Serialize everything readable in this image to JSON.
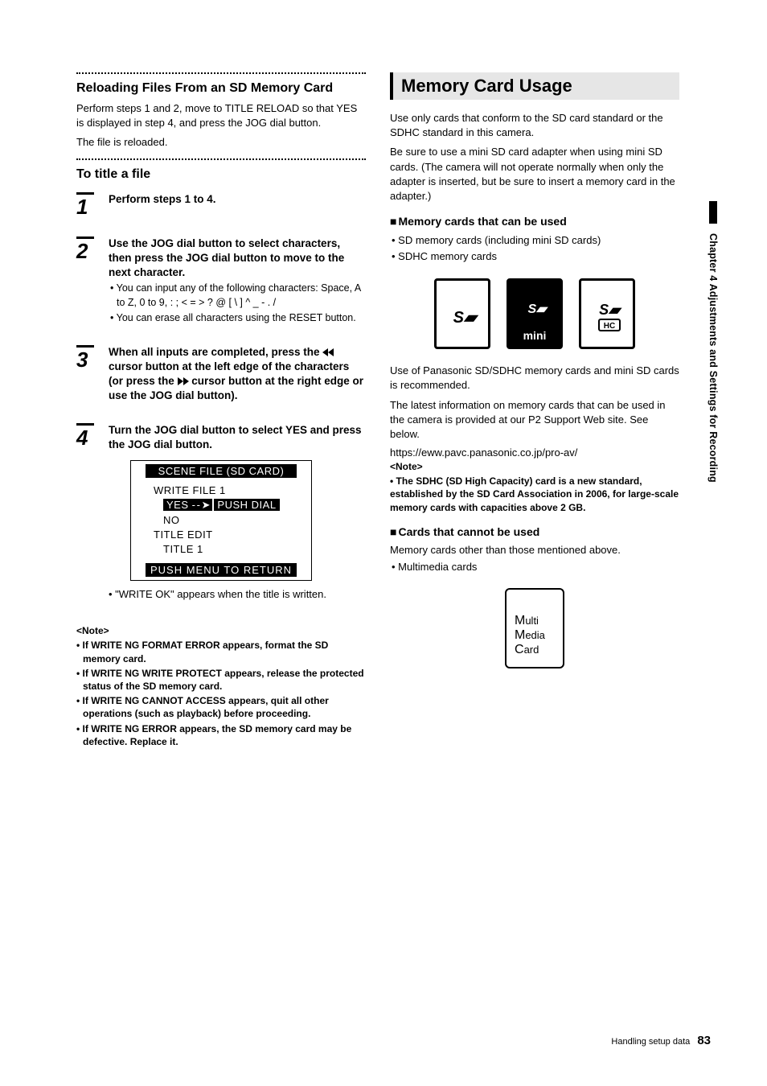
{
  "left": {
    "h1": "Reloading Files From an SD Memory Card",
    "p1": "Perform steps 1 and 2, move to TITLE RELOAD so that YES is displayed in step 4, and press the JOG dial button.",
    "p2": "The file is reloaded.",
    "h2": "To title a file",
    "steps": {
      "s1": {
        "lead": "Perform steps 1 to 4."
      },
      "s2": {
        "lead": "Use the JOG dial button to select characters, then press the JOG dial button to move to the next character.",
        "b1": "• You can input any of the following characters: Space, A to Z, 0 to 9, : ; < = > ? @ [ \\ ] ^ _ - . /",
        "b2": "• You can erase all characters using the RESET button."
      },
      "s3": {
        "lead_a": "When all inputs are completed, press the ",
        "lead_b": " cursor button at the left edge of the characters (or press the ",
        "lead_c": " cursor button at the right edge or use the JOG dial button)."
      },
      "s4": {
        "lead": "Turn the JOG dial button to select YES and press the JOG dial button."
      }
    },
    "menu": {
      "title": "SCENE FILE (SD CARD)",
      "r1": "WRITE FILE 1",
      "r2a": "YES",
      "r2b": "- - ➤",
      "r2c": "PUSH DIAL",
      "r3": "NO",
      "r4": "TITLE EDIT",
      "r5": "TITLE 1",
      "bottom": "PUSH  MENU  TO  RETURN"
    },
    "after_menu": "• \"WRITE OK\" appears when the title is written.",
    "notes": {
      "head": "<Note>",
      "n1": "• If WRITE NG FORMAT ERROR appears, format the SD memory card.",
      "n2": "• If WRITE NG WRITE PROTECT appears, release the protected status of the SD memory card.",
      "n3": "• If WRITE NG CANNOT ACCESS appears, quit all other operations (such as playback) before proceeding.",
      "n4": "• If WRITE NG ERROR appears, the SD memory card may be defective. Replace it."
    }
  },
  "right": {
    "title": "Memory Card Usage",
    "p1": "Use only cards that conform to the SD card standard or the SDHC standard in this camera.",
    "p2": "Be sure to use a mini SD card adapter when using mini SD cards. (The camera will not operate normally when only the adapter is inserted, but be sure to insert a memory card in the adapter.)",
    "h1": "Memory cards that can be used",
    "b1": "• SD memory cards (including mini SD cards)",
    "b2": "• SDHC memory cards",
    "p3": "Use of Panasonic SD/SDHC memory cards and mini SD cards is recommended.",
    "p4": "The latest information on memory cards that can be used in the camera is provided at our P2 Support Web site. See below.",
    "url": "https://eww.pavc.panasonic.co.jp/pro-av/",
    "notehead": "<Note>",
    "note1": "• The SDHC (SD High Capacity) card is a new standard, established by the SD Card Association in 2006, for large-scale memory cards with capacities above 2 GB.",
    "h2": "Cards that cannot be used",
    "p5": "Memory cards other than those mentioned above.",
    "b3": "• Multimedia cards",
    "mmc": {
      "l1": "Multi",
      "l2": "Media",
      "l3": "Card"
    },
    "cards": {
      "mini": "mini",
      "sdhc_top": "S≥",
      "sdhc_bot": "HC"
    }
  },
  "side_tab": "Chapter 4 Adjustments and Settings for Recording",
  "footer": {
    "label": "Handling setup data",
    "page": "83"
  }
}
